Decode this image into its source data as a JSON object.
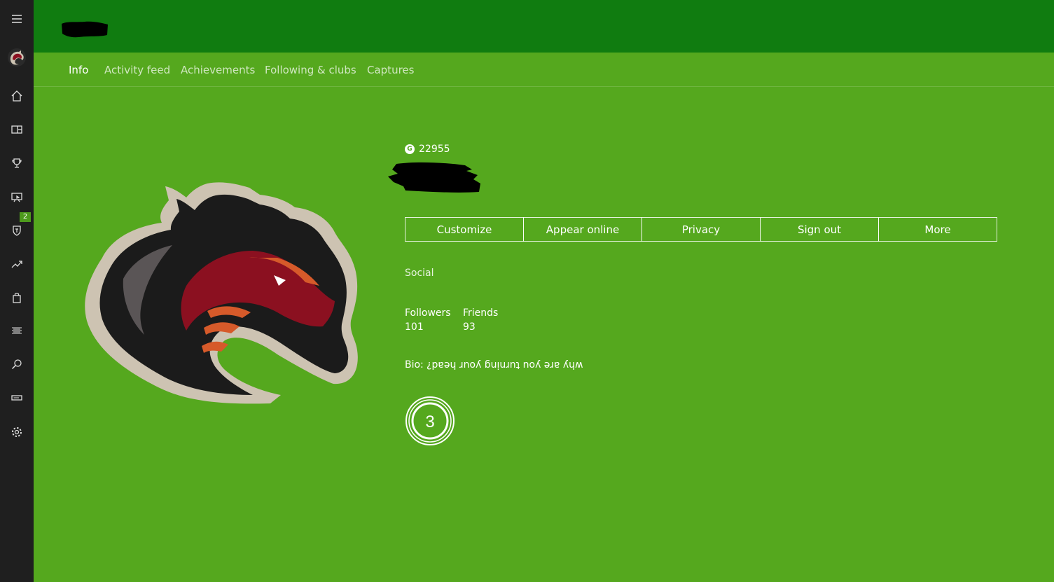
{
  "sidebar": {
    "items": [
      {
        "icon": "hamburger-menu-icon"
      },
      {
        "icon": "profile-avatar-icon"
      },
      {
        "icon": "home-icon"
      },
      {
        "icon": "my-games-icon"
      },
      {
        "icon": "achievements-trophy-icon"
      },
      {
        "icon": "game-dvr-icon"
      },
      {
        "icon": "clubs-shield-icon",
        "badge": "2"
      },
      {
        "icon": "trending-icon"
      },
      {
        "icon": "store-bag-icon"
      },
      {
        "icon": "activity-list-icon"
      },
      {
        "icon": "search-icon"
      },
      {
        "icon": "connection-icon"
      },
      {
        "icon": "settings-gear-icon"
      }
    ]
  },
  "tabs": [
    {
      "label": "Info",
      "active": true
    },
    {
      "label": "Activity feed"
    },
    {
      "label": "Achievements"
    },
    {
      "label": "Following & clubs"
    },
    {
      "label": "Captures"
    }
  ],
  "profile": {
    "gamerscore_icon": "G",
    "gamerscore": "22955",
    "buttons": {
      "customize": "Customize",
      "appear_online": "Appear online",
      "privacy": "Privacy",
      "sign_out": "Sign out",
      "more": "More"
    },
    "social_heading": "Social",
    "followers_label": "Followers",
    "followers_value": "101",
    "friends_label": "Friends",
    "friends_value": "93",
    "bio_prefix": "Bio:",
    "bio_text": "why are you turning your head?",
    "reputation_level": "3"
  },
  "colors": {
    "sidebar": "#1f1f1f",
    "header": "#107c10",
    "background": "#55a81e",
    "dragon_black": "#1b1b1b",
    "dragon_red": "#8b1020",
    "dragon_orange": "#d65a2a",
    "dragon_outline": "#cdc3b2"
  }
}
